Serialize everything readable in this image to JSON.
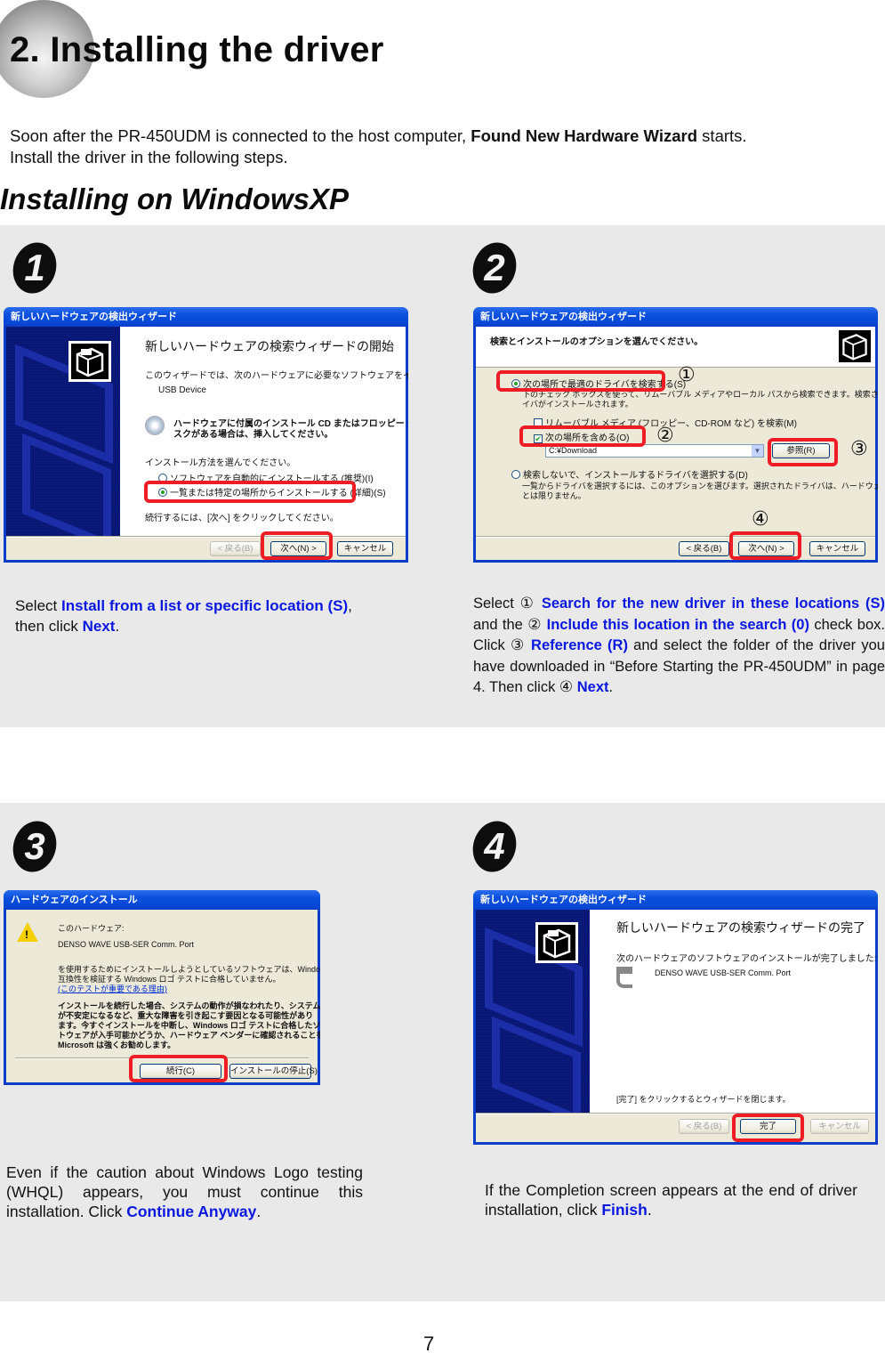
{
  "header": {
    "title": "2. Installing the driver",
    "intro_line1_pre": "Soon after the PR-450UDM is connected to the host computer, ",
    "intro_line1_bold": "Found New Hardware Wizard",
    "intro_line1_post": " starts.",
    "intro_line2": "Install the driver in the following steps."
  },
  "section_title": "Installing on WindowsXP",
  "steps": [
    {
      "number": "1",
      "dialog": {
        "title": "新しいハードウェアの検出ウィザード",
        "heading": "新しいハードウェアの検索ウィザードの開始",
        "line1": "このウィザードでは、次のハードウェアに必要なソフトウェアをインストールします:",
        "device": "USB Device",
        "cd_text_1": "ハードウェアに付属のインストール CD またはフロッピー ディ",
        "cd_text_2": "スクがある場合は、挿入してください。",
        "choose_label": "インストール方法を選んでください。",
        "option_auto": "ソフトウェアを自動的にインストールする (推奨)(I)",
        "option_list": "一覧または特定の場所からインストールする (詳細)(S)",
        "selected_option": "option_list",
        "continue_hint": "続行するには、[次へ] をクリックしてください。",
        "btn_back": "< 戻る(B)",
        "btn_next": "次へ(N) >",
        "btn_cancel": "キャンセル"
      },
      "description": {
        "pre": "Select ",
        "hl1": "Install from a list or specific location (S)",
        "mid": ",",
        "line2_pre": "then click ",
        "hl2": "Next",
        "end": "."
      }
    },
    {
      "number": "2",
      "dialog": {
        "title": "新しいハードウェアの検出ウィザード",
        "heading": "検索とインストールのオプションを選んでください。",
        "option_search": "次の場所で最適のドライバを検索する(S)",
        "search_desc_1": "下のチェック ボックスを使って、リムーバブル メディアやローカル パスから検索できます。検索された最適のドラ",
        "search_desc_2": "イバがインストールされます。",
        "check_removable": "リムーバブル メディア (フロッピー、CD-ROM など) を検索(M)",
        "check_removable_checked": false,
        "check_include": "次の場所を含める(O)",
        "check_include_checked": true,
        "path_value": "C:¥Download",
        "btn_browse": "参照(R)",
        "option_manual": "検索しないで、インストールするドライバを選択する(D)",
        "manual_desc_1": "一覧からドライバを選択するには、このオプションを選びます。選択されたドライバは、ハードウェアに最適のもの",
        "manual_desc_2": "とは限りません。",
        "btn_back": "< 戻る(B)",
        "btn_next": "次へ(N) >",
        "btn_cancel": "キャンセル",
        "markers": [
          "①",
          "②",
          "③",
          "④"
        ]
      },
      "description": {
        "select": "Select ",
        "m1": "①",
        "hl1": "Search for the new driver in these locations (S)",
        "and_the": " and the ",
        "m2": "②",
        "hl2": "Include this location in the search (0)",
        "check_box": " check box. Click ",
        "m3": "③",
        "hl3": "Reference (R)",
        "rest": " and select the folder of the driver you have downloaded in “Before Starting the PR-450UDM” in page 4. Then click ",
        "m4": "④",
        "hl4": "Next",
        "end": "."
      }
    },
    {
      "number": "3",
      "dialog": {
        "title": "ハードウェアのインストール",
        "line1": "このハードウェア:",
        "device": "DENSO WAVE USB-SER Comm. Port",
        "warn_1": "を使用するためにインストールしようとしているソフトウェアは、Windows XP との",
        "warn_2": "互換性を検証する Windows ロゴ テストに合格していません。",
        "link": "(このテストが重要である理由)",
        "bold_1": "インストールを続行した場合、システムの動作が損なわれたり、システム",
        "bold_2": "が不安定になるなど、重大な障害を引き起こす要因となる可能性があり",
        "bold_3": "ます。今すぐインストールを中断し、Windows ロゴ テストに合格したソフ",
        "bold_4": "トウェアが入手可能かどうか、ハードウェア ベンダーに確認されることを、",
        "bold_5": "Microsoft は強くお勧めします。",
        "btn_continue": "続行(C)",
        "btn_stop": "インストールの停止(S)"
      },
      "description": {
        "text": "Even if the caution about Windows Logo testing (WHQL) appears, you must continue this installation. Click ",
        "hl": "Continue Anyway",
        "end": "."
      }
    },
    {
      "number": "4",
      "dialog": {
        "title": "新しいハードウェアの検出ウィザード",
        "heading": "新しいハードウェアの検索ウィザードの完了",
        "line1": "次のハードウェアのソフトウェアのインストールが完了しました:",
        "device": "DENSO WAVE USB-SER Comm. Port",
        "finish_hint": "[完了] をクリックするとウィザードを閉じます。",
        "btn_back": "< 戻る(B)",
        "btn_finish": "完了",
        "btn_cancel": "キャンセル"
      },
      "description": {
        "text": "If the Completion screen appears at the end of driver installation, click ",
        "hl": "Finish",
        "end": "."
      }
    }
  ],
  "page_number": "7",
  "colors": {
    "highlight_text": "#0a18e0",
    "annotation_red": "#ee1c24",
    "panel_gray": "#e9e9e9",
    "xp_blue": "#0a3ec8"
  }
}
